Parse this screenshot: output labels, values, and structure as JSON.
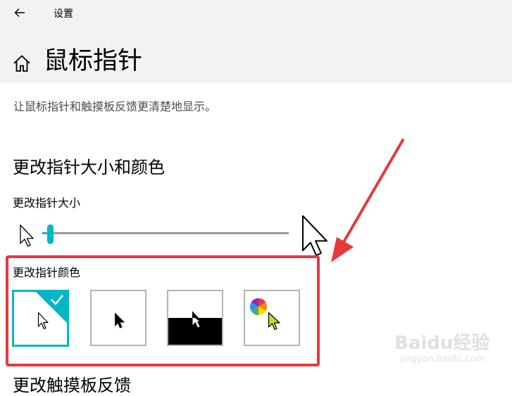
{
  "window": {
    "app_title": "设置"
  },
  "page": {
    "title": "鼠标指针",
    "description": "让鼠标指针和触摸板反馈更清楚地显示。"
  },
  "section": {
    "title": "更改指针大小和颜色",
    "size_label": "更改指针大小",
    "size_value_fraction": 0.02,
    "color_label": "更改指针颜色",
    "color_options": [
      {
        "name": "white",
        "selected": true
      },
      {
        "name": "black",
        "selected": false
      },
      {
        "name": "inverted",
        "selected": false
      },
      {
        "name": "custom",
        "selected": false
      }
    ],
    "next_heading": "更改触摸板反馈"
  },
  "colors": {
    "accent": "#00b7c3",
    "annotation": "#e8383d",
    "custom_cursor": "#b5e61d"
  },
  "watermark": {
    "text": "Baidu经验",
    "sub": "jingyan.baidu.com"
  },
  "icons": [
    "back-arrow-icon",
    "home-icon",
    "small-pointer-icon",
    "large-pointer-icon",
    "checkmark-icon",
    "color-wheel-icon"
  ]
}
